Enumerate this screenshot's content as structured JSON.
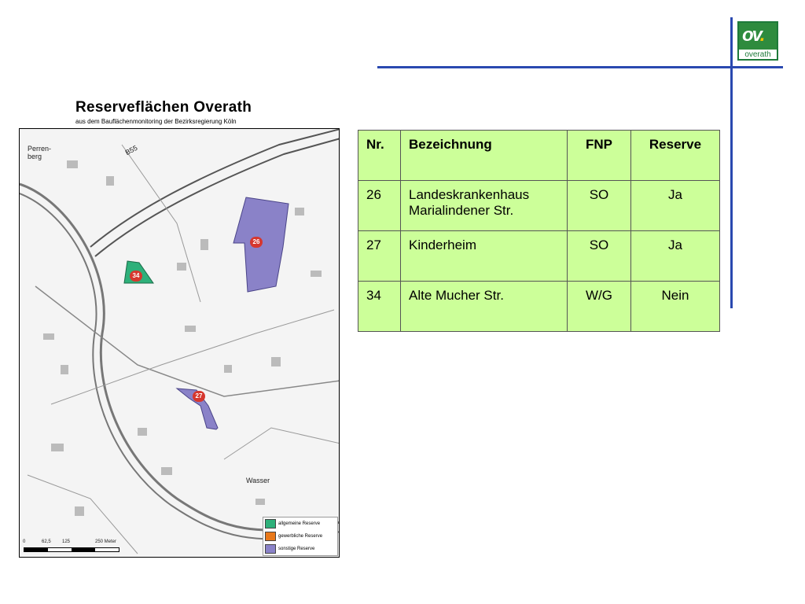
{
  "logo": {
    "mark": "ov",
    "dot": ".",
    "word": "overath"
  },
  "map": {
    "title": "Reserveflächen Overath",
    "subtitle": "aus dem Bauflächenmonitoring der Bezirksregierung Köln",
    "labels": {
      "perrenberg": "Perren-\nberg",
      "road": "B55",
      "wasser": "Wasser"
    },
    "markers": [
      "26",
      "34",
      "27"
    ],
    "legend": [
      {
        "label": "allgemeine Reserve",
        "color": "#2eb07a"
      },
      {
        "label": "gewerbliche Reserve",
        "color": "#e8781a"
      },
      {
        "label": "sonstige Reserve",
        "color": "#8a82c8"
      }
    ],
    "scale": [
      "0",
      "62,5",
      "125",
      "250 Meter"
    ]
  },
  "table": {
    "headers": [
      "Nr.",
      "Bezeichnung",
      "FNP",
      "Reserve"
    ],
    "rows": [
      [
        "26",
        "Landeskrankenhaus Marialindener Str.",
        "SO",
        "Ja"
      ],
      [
        "27",
        "Kinderheim",
        "SO",
        "Ja"
      ],
      [
        "34",
        "Alte Mucher Str.",
        "W/G",
        "Nein"
      ]
    ]
  },
  "colors": {
    "accent_line": "#2a49b0",
    "table_bg": "#ccff99",
    "marker": "#d6372e"
  }
}
